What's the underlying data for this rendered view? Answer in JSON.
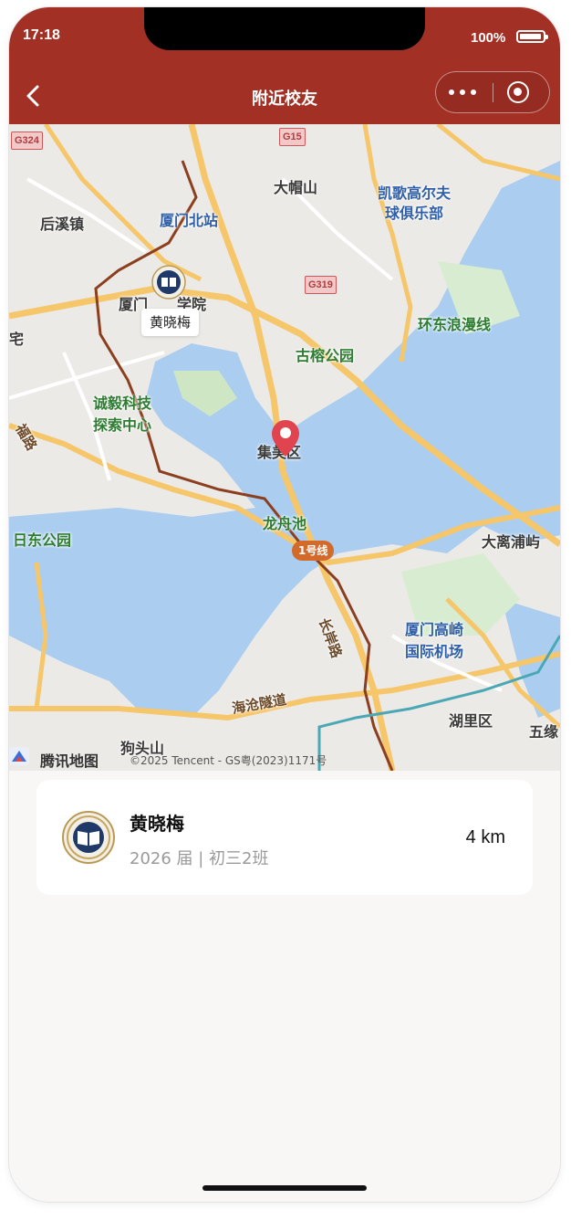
{
  "status_bar": {
    "time": "17:18",
    "battery": "100%"
  },
  "nav": {
    "title": "附近校友"
  },
  "map": {
    "labels": {
      "l1": "大帽山",
      "l2": "凯歌高尔夫",
      "l3": "球俱乐部",
      "l4": "后溪镇",
      "l5": "厦门北站",
      "l6": "厦门",
      "l6b": "学院",
      "l7": "宅",
      "l8": "古榕公园",
      "l9": "环东浪漫线",
      "l10": "诚毅科技",
      "l11": "探索中心",
      "l12": "集美区",
      "l13": "龙舟池",
      "l14": "大离浦屿",
      "l15": "日东公园",
      "l16": "厦门高崎",
      "l17": "国际机场",
      "l18": "长岸路",
      "l19": "海沧隧道",
      "l20": "湖里区",
      "l21": "五缘",
      "l22": "狗头山",
      "l23": "福路"
    },
    "highway_1": "G324",
    "highway_2": "G319",
    "highway_3": "G15",
    "metro_label": "1号线",
    "callout_name": "黄晓梅",
    "logo_text": "腾讯地图",
    "copyright": "©2025 Tencent - GS粤(2023)1171号"
  },
  "alumni": [
    {
      "name": "黄晓梅",
      "meta": "2026 届 | 初三2班",
      "distance": "4 km"
    }
  ],
  "colors": {
    "header": "#a33024",
    "water": "#aacdf0",
    "land": "#eceae6"
  }
}
